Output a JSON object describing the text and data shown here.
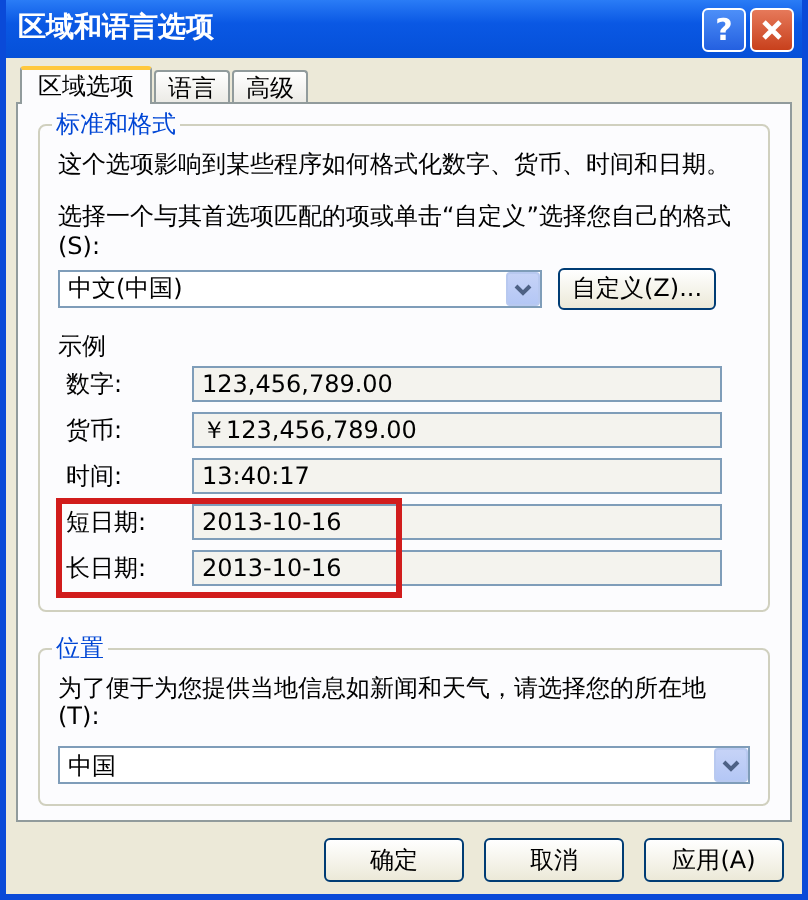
{
  "window": {
    "title": "区域和语言选项",
    "help_button": "?"
  },
  "tabs": [
    {
      "label": "区域选项",
      "selected": true
    },
    {
      "label": "语言",
      "selected": false
    },
    {
      "label": "高级",
      "selected": false
    }
  ],
  "format_group": {
    "title": "标准和格式",
    "description": "这个选项影响到某些程序如何格式化数字、货币、时间和日期。",
    "prompt": "选择一个与其首选项匹配的项或单击“自定义”选择您自己的格式(S):",
    "locale_select": {
      "value": "中文(中国)"
    },
    "customize_button": "自定义(Z)...",
    "sample_title": "示例",
    "samples": [
      {
        "label": "数字:",
        "value": "123,456,789.00",
        "highlighted": false
      },
      {
        "label": "货币:",
        "value": "￥123,456,789.00",
        "highlighted": false
      },
      {
        "label": "时间:",
        "value": "13:40:17",
        "highlighted": false
      },
      {
        "label": "短日期:",
        "value": "2013-10-16",
        "highlighted": true
      },
      {
        "label": "长日期:",
        "value": "2013-10-16",
        "highlighted": true
      }
    ]
  },
  "location_group": {
    "title": "位置",
    "description": "为了便于为您提供当地信息如新闻和天气，请选择您的所在地(T):",
    "select": {
      "value": "中国"
    }
  },
  "buttons": [
    {
      "label": "确定"
    },
    {
      "label": "取消"
    },
    {
      "label": "应用(A)"
    }
  ]
}
